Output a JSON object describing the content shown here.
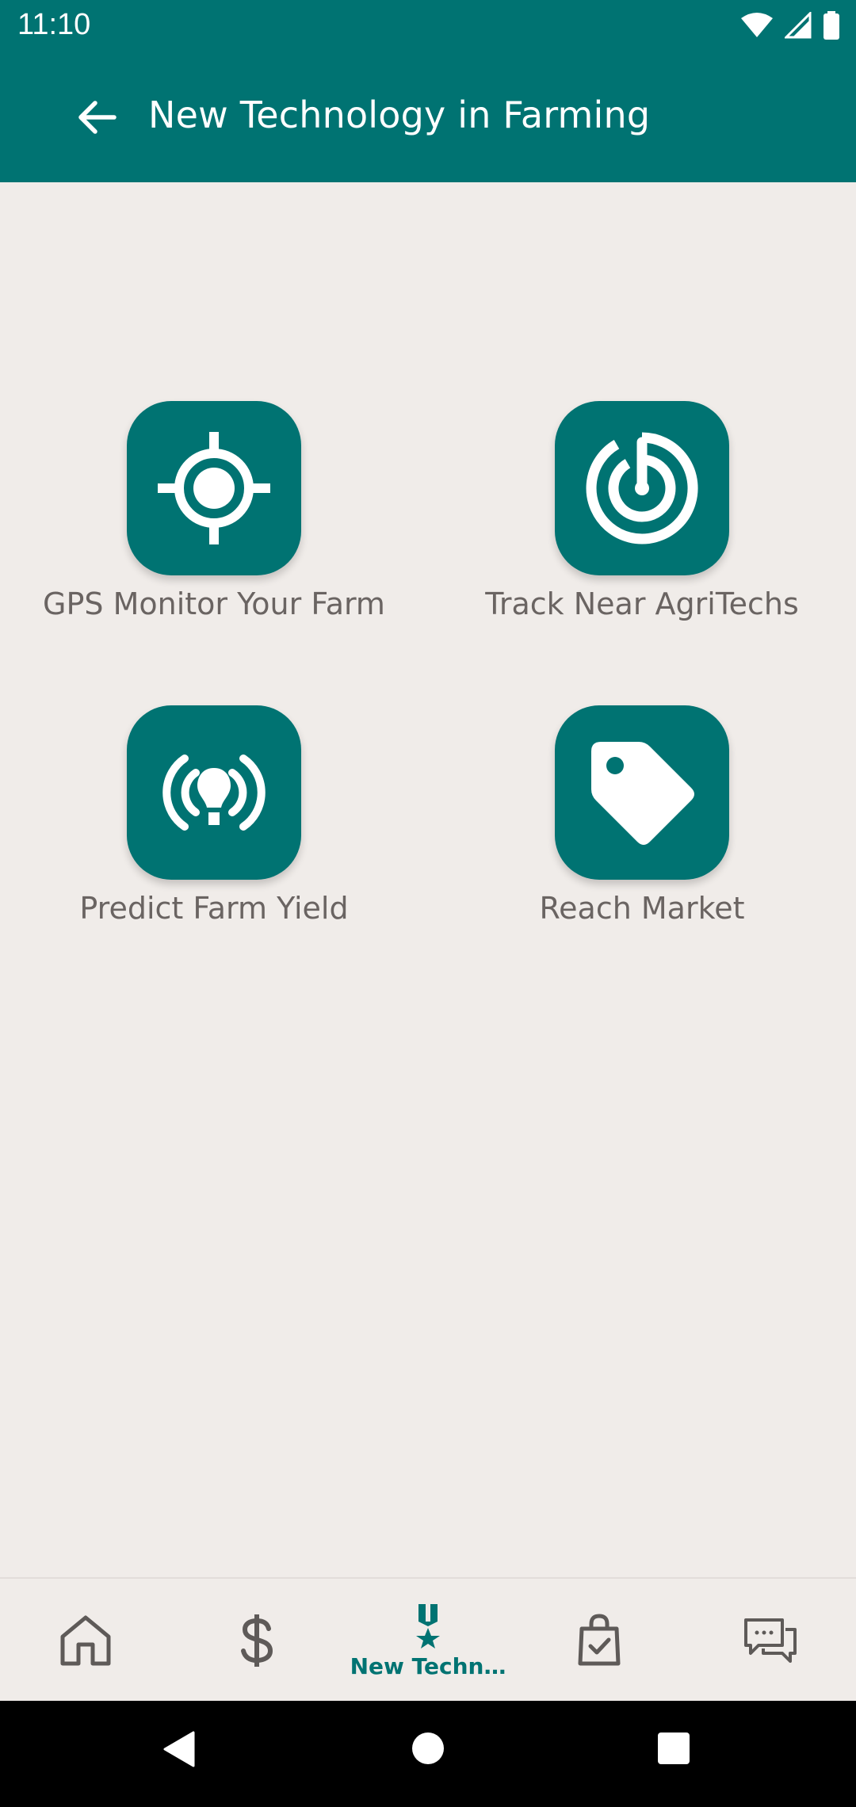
{
  "status_bar": {
    "time": "11:10"
  },
  "app_bar": {
    "title": "New Technology in Farming"
  },
  "tiles": [
    {
      "label": "GPS Monitor Your Farm",
      "icon": "gps-target-icon"
    },
    {
      "label": "Track Near AgriTechs",
      "icon": "radar-icon"
    },
    {
      "label": "Predict Farm Yield",
      "icon": "lightbulb-signal-icon"
    },
    {
      "label": "Reach Market",
      "icon": "tag-icon"
    }
  ],
  "bottom_nav": {
    "items": [
      {
        "icon": "home-icon"
      },
      {
        "icon": "dollar-icon"
      },
      {
        "icon": "medal-icon",
        "label": "New Techn…",
        "active": true
      },
      {
        "icon": "shopping-bag-icon"
      },
      {
        "icon": "chat-icon"
      }
    ]
  },
  "colors": {
    "primary": "#007372",
    "background": "#F0ECE9",
    "text_muted": "#6A6462"
  }
}
